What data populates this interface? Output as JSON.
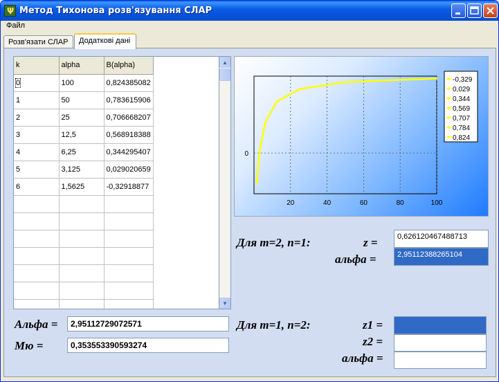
{
  "window": {
    "title": "Метод Тихонова розв'язування СЛАР"
  },
  "menu": {
    "file": "Файл"
  },
  "tabs": [
    {
      "label": "Розв'язати СЛАР"
    },
    {
      "label": "Додаткові дані"
    }
  ],
  "grid": {
    "headers": [
      "k",
      "alpha",
      "B(alpha)"
    ],
    "rows": [
      [
        "0",
        "100",
        "0,824385082"
      ],
      [
        "1",
        "50",
        "0,783615906"
      ],
      [
        "2",
        "25",
        "0,706668207"
      ],
      [
        "3",
        "12,5",
        "0,568918388"
      ],
      [
        "4",
        "6,25",
        "0,344295407"
      ],
      [
        "5",
        "3,125",
        "0,029020659"
      ],
      [
        "6",
        "1,5625",
        "-0,32918877"
      ]
    ]
  },
  "chart_data": {
    "type": "line",
    "x": [
      1.5625,
      3.125,
      6.25,
      12.5,
      25,
      50,
      100
    ],
    "values": [
      -0.329,
      0.029,
      0.344,
      0.569,
      0.707,
      0.784,
      0.824
    ],
    "xlim": [
      0,
      100
    ],
    "ylim": [
      -0.45,
      0.85
    ],
    "xticks": [
      "20",
      "40",
      "60",
      "80",
      "100"
    ],
    "yticks": [
      "0"
    ],
    "legend": [
      "-0,329",
      "0,029",
      "0,344",
      "0,569",
      "0,707",
      "0,784",
      "0,824"
    ],
    "legend_position": "top-right",
    "grid": true,
    "line_color": "#FFFF00"
  },
  "case1": {
    "caption": "Для m=2, n=1:",
    "z_label": "z =",
    "z_value": "0,626120467488713",
    "alpha_label": "альфа =",
    "alpha_value": "2,95112388265104"
  },
  "case2": {
    "caption": "Для m=1, n=2:",
    "z1_label": "z1 =",
    "z2_label": "z2 =",
    "alpha_label": "альфа ="
  },
  "params": {
    "alpha_label": "Альфа =",
    "alpha_value": "2,95112729072571",
    "mu_label": "Мю =",
    "mu_value": "0,353553390593274"
  }
}
